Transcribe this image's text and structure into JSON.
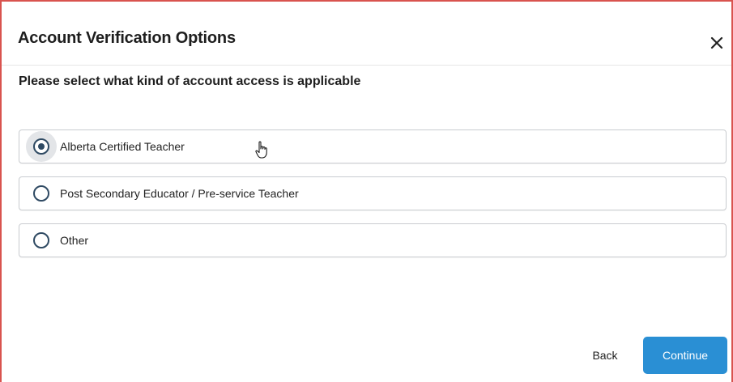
{
  "dialog": {
    "title": "Account Verification Options",
    "subtitle": "Please select what kind of account access is applicable",
    "close_icon": "close-icon"
  },
  "options": [
    {
      "label": "Alberta Certified Teacher",
      "selected": true
    },
    {
      "label": "Post Secondary Educator / Pre-service Teacher",
      "selected": false
    },
    {
      "label": "Other",
      "selected": false
    }
  ],
  "footer": {
    "back_label": "Back",
    "continue_label": "Continue"
  },
  "colors": {
    "accent": "#2a8fd4",
    "radio": "#2f4a63",
    "frame": "#d9534f"
  }
}
